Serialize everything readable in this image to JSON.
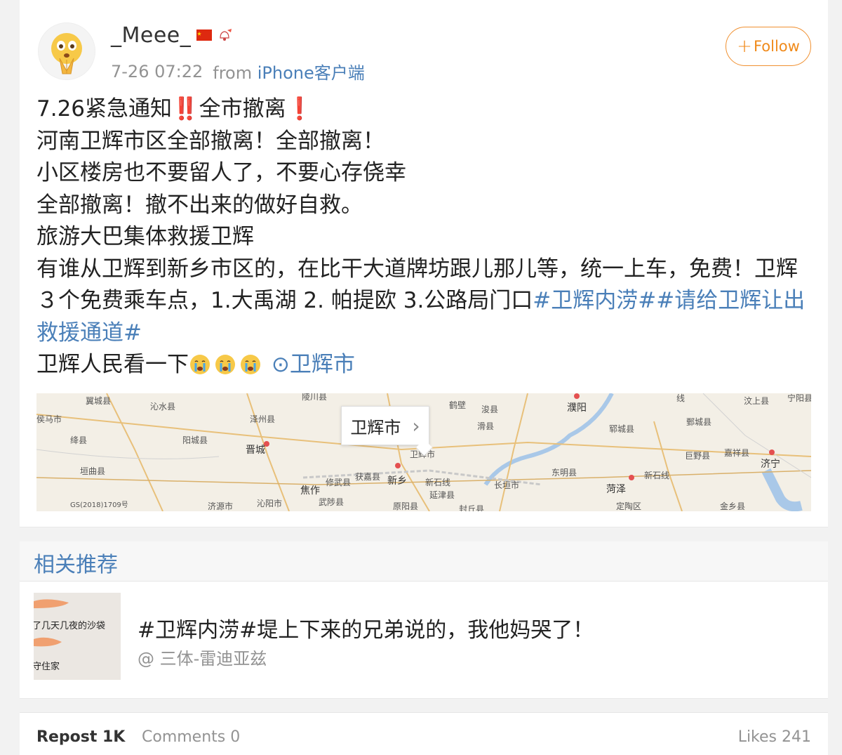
{
  "post": {
    "username": "_Meee_",
    "timestamp": "7-26 07:22",
    "from_label": "from",
    "source": "iPhone客户端",
    "follow_label": "Follow",
    "follow_plus": "+",
    "body": {
      "line1_a": "7.26紧急通知",
      "line1_mark1": "‼️",
      "line1_b": "全市撤离",
      "line1_mark2": "❗",
      "line2": "河南卫辉市区全部撤离！全部撤离！",
      "line3": "小区楼房也不要留人了，不要心存侥幸",
      "line4": "全部撤离！撤不出来的做好自救。",
      "line5": "旅游大巴集体救援卫辉",
      "line6_a": "有谁从卫辉到新乡市区的，在比干大道牌坊跟儿那儿等，统一上车，免费！卫辉３个免费乘车点，1.大禹湖 2. 帕提欧 3.公路局门口",
      "hashtag1": "#卫辉内涝#",
      "hashtag2": "#请给卫辉让出救援通道#",
      "line7": "卫辉人民看一下",
      "location_pin": "⊙",
      "location": "卫辉市"
    }
  },
  "map": {
    "callout_label": "卫辉市",
    "callout_chevron": "›",
    "labels": [
      {
        "text": "翼城县"
      },
      {
        "text": "沁水县"
      },
      {
        "text": "陵川县"
      },
      {
        "text": "鹤壁"
      },
      {
        "text": "浚县"
      },
      {
        "text": "濮阳"
      },
      {
        "text": "汶上县"
      },
      {
        "text": "宁阳县"
      },
      {
        "text": "侯马市"
      },
      {
        "text": "泽州县"
      },
      {
        "text": "滑县"
      },
      {
        "text": "郓城县"
      },
      {
        "text": "鄄城县"
      },
      {
        "text": "绛县"
      },
      {
        "text": "阳城县"
      },
      {
        "text": "晋城"
      },
      {
        "text": "卫辉市"
      },
      {
        "text": "巨野县"
      },
      {
        "text": "嘉祥县"
      },
      {
        "text": "济宁"
      },
      {
        "text": "垣曲县"
      },
      {
        "text": "修武县"
      },
      {
        "text": "获嘉县"
      },
      {
        "text": "新乡"
      },
      {
        "text": "新石线"
      },
      {
        "text": "东明县"
      },
      {
        "text": "新石线"
      },
      {
        "text": "焦作"
      },
      {
        "text": "长垣市"
      },
      {
        "text": "菏泽"
      },
      {
        "text": "延津县"
      },
      {
        "text": "济源市"
      },
      {
        "text": "沁阳市"
      },
      {
        "text": "武陟县"
      },
      {
        "text": "原阳县"
      },
      {
        "text": "封丘县"
      },
      {
        "text": "定陶区"
      },
      {
        "text": "金乡县"
      },
      {
        "text": "GS(2018)1709号"
      },
      {
        "text": "线"
      }
    ]
  },
  "related": {
    "title": "相关推荐",
    "item": {
      "title": "#卫辉内涝#堤上下来的兄弟说的，我他妈哭了！",
      "author": "@ 三体-雷迪亚兹",
      "thumb_text1": "了几天几夜的沙袋",
      "thumb_text2": "守住家"
    }
  },
  "stats": {
    "reposts": "Repost 1K",
    "comments": "Comments 0",
    "likes": "Likes 241"
  },
  "colors": {
    "link": "#4a7fb8",
    "follow": "#f08a1a",
    "alert": "#e0222a"
  }
}
